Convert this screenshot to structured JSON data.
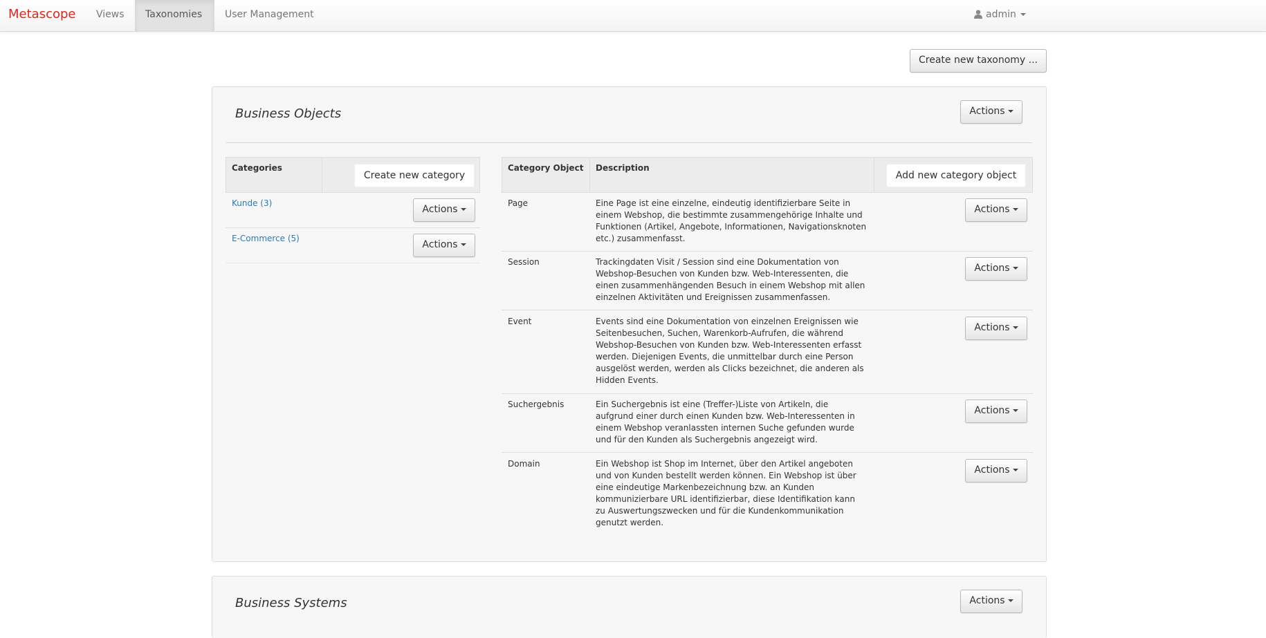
{
  "navbar": {
    "brand": "Metascope",
    "items": [
      {
        "label": "Views"
      },
      {
        "label": "Taxonomies"
      },
      {
        "label": "User Management"
      }
    ],
    "user": "admin"
  },
  "toolbar": {
    "create_taxonomy": "Create new taxonomy ..."
  },
  "taxonomies": [
    {
      "title": "Business Objects",
      "actions_label": "Actions",
      "categories_table": {
        "header": "Categories",
        "create_button": "Create new category",
        "rows": [
          {
            "name": "Kunde (3)",
            "actions": "Actions"
          },
          {
            "name": "E-Commerce (5)",
            "actions": "Actions"
          }
        ]
      },
      "objects_table": {
        "headers": [
          "Category Object",
          "Description"
        ],
        "add_button": "Add new category object",
        "rows": [
          {
            "name": "Page",
            "lines": [
              "Eine Page ist eine einzelne, eindeutig identifizierbare Seite in",
              "einem Webshop, die bestimmte zusammengehörige Inhalte und",
              "Funktionen (Artikel, Angebote, Informationen, Navigationsknoten",
              "etc.) zusammenfasst."
            ],
            "actions": "Actions"
          },
          {
            "name": "Session",
            "lines": [
              "Trackingdaten Visit / Session sind eine Dokumentation von",
              "Webshop-Besuchen von Kunden bzw. Web-Interessenten, die",
              "einen zusammenhängenden Besuch in einem Webshop mit allen",
              "einzelnen Aktivitäten und Ereignissen zusammenfassen."
            ],
            "actions": "Actions"
          },
          {
            "name": "Event",
            "lines": [
              "Events sind eine Dokumentation von einzelnen Ereignissen wie",
              "Seitenbesuchen, Suchen, Warenkorb-Aufrufen, die während",
              "Webshop-Besuchen von Kunden bzw. Web-Interessenten erfasst",
              "werden. Diejenigen Events, die unmittelbar durch eine Person",
              "ausgelöst werden, werden als Clicks bezeichnet, die anderen als",
              "Hidden Events."
            ],
            "actions": "Actions"
          },
          {
            "name": "Suchergebnis",
            "lines": [
              "Ein Suchergebnis ist eine (Treffer-)Liste von Artikeln, die",
              "aufgrund einer durch einen Kunden bzw. Web-Interessenten in",
              "einem Webshop veranlassten internen Suche gefunden wurde",
              "und für den Kunden als Suchergebnis angezeigt wird."
            ],
            "actions": "Actions"
          },
          {
            "name": "Domain",
            "lines": [
              "Ein Webshop ist Shop im Internet, über den Artikel angeboten",
              "und von Kunden bestellt werden können. Ein Webshop ist über",
              "eine eindeutige Markenbezeichnung bzw. an Kunden",
              "kommunizierbare URL identifizierbar, diese Identifikation kann",
              "zu Auswertungszwecken und für die Kundenkommunikation",
              "genutzt werden."
            ],
            "actions": "Actions"
          }
        ]
      }
    },
    {
      "title": "Business Systems",
      "actions_label": "Actions"
    }
  ],
  "colors": {
    "brand": "#d9291f",
    "link": "#2a7ab8",
    "panel": "#f7f7f7"
  },
  "icons": {
    "user": "user-icon",
    "caret": "caret-down-icon"
  }
}
